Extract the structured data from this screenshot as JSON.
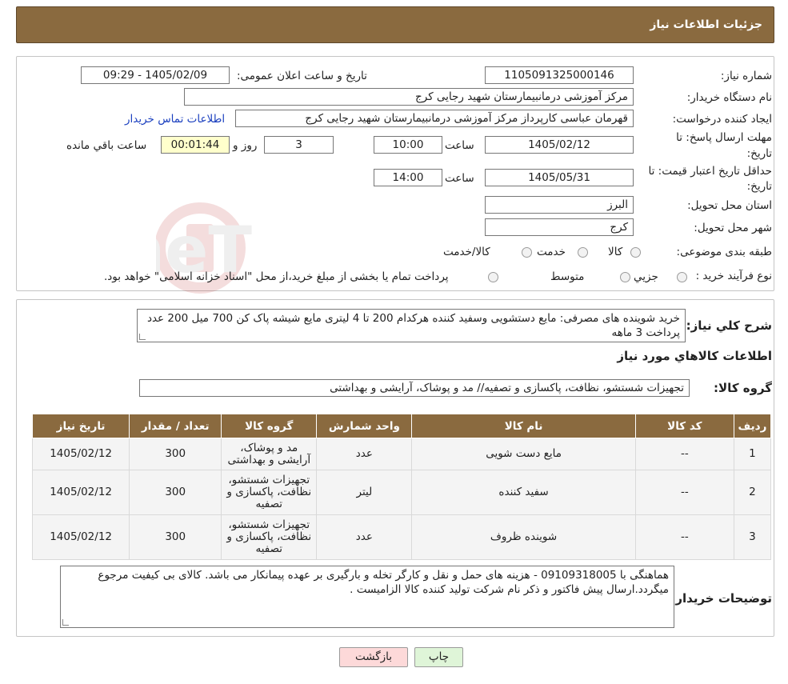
{
  "header": {
    "title": "جزئیات اطلاعات نیاز"
  },
  "form": {
    "need_number_label": "شماره نیاز:",
    "need_number": "1105091325000146",
    "announce_label": "تاریخ و ساعت اعلان عمومی:",
    "announce_value": "1405/02/09 - 09:29",
    "buyer_label": "نام دستگاه خریدار:",
    "buyer_value": "مرکز آموزشی درمانبیمارستان شهید رجایی کرج",
    "creator_label": "ایجاد کننده درخواست:",
    "creator_value": "قهرمان عباسی کارپرداز مرکز آموزشی درمانبیمارستان شهید رجایی کرج",
    "contact_link": "اطلاعات تماس خریدار",
    "reply_label_line1": "مهلت ارسال پاسخ: تا",
    "reply_label_line2": "تاریخ:",
    "reply_date": "1405/02/12",
    "time_label": "ساعت",
    "reply_time": "10:00",
    "days_value": "3",
    "days_label": "روز و",
    "remaining_value": "00:01:44",
    "remaining_label": "ساعت باقي مانده",
    "validity_label_line1": "حداقل تاریخ اعتبار قیمت: تا",
    "validity_label_line2": "تاریخ:",
    "validity_date": "1405/05/31",
    "validity_time": "14:00",
    "province_label": "استان محل تحویل:",
    "province_value": "البرز",
    "city_label": "شهر محل تحویل:",
    "city_value": "کرج",
    "category_label": "طبقه بندی موضوعی:",
    "category_options": [
      "کالا",
      "خدمت",
      "کالا/خدمت"
    ],
    "process_label": "نوع فرآیند خرید :",
    "process_options": [
      "جزیي",
      "متوسط"
    ],
    "process_note": "پرداخت تمام یا بخشی از مبلغ خرید،از محل \"اسناد خزانه اسلامی\" خواهد بود."
  },
  "details": {
    "description_label": "شرح کلي نياز:",
    "description_text": "خرید شوینده های مصرفی: مایع دستشویی وسفید کننده هرکدام  200 تا 4 لیتری مایع  شیشه پاک کن  700 میل  200 عدد   پرداخت  3 ماهه",
    "goods_info_title": "اطلاعات کالاهاي مورد نياز",
    "goods_group_label": "گروه کالا:",
    "goods_group_value": "تجهیزات شستشو، نظافت، پاکسازی و تصفیه// مد و پوشاک، آرایشی و بهداشتی"
  },
  "table": {
    "headers": [
      "ردیف",
      "کد کالا",
      "نام کالا",
      "واحد شمارش",
      "گروه کالا",
      "تعداد / مقدار",
      "تاریخ نیاز"
    ],
    "rows": [
      {
        "row": "1",
        "code": "--",
        "name": "مایع دست شویی",
        "unit": "عدد",
        "group": "مد و پوشاک، آرایشی و بهداشتی",
        "qty": "300",
        "date": "1405/02/12"
      },
      {
        "row": "2",
        "code": "--",
        "name": "سفید کننده",
        "unit": "لیتر",
        "group": "تجهیزات شستشو، نظافت، پاکسازی و تصفیه",
        "qty": "300",
        "date": "1405/02/12"
      },
      {
        "row": "3",
        "code": "--",
        "name": "شوینده ظروف",
        "unit": "عدد",
        "group": "تجهیزات شستشو، نظافت، پاکسازی و تصفیه",
        "qty": "300",
        "date": "1405/02/12"
      }
    ]
  },
  "buyer_notes": {
    "label": "توضیحات خریدار:",
    "text": "هماهنگی با 09109318005 - هزینه های  حمل و نقل و کارگر تخله و بارگیری بر عهده پیمانکار می باشد. کالای بی کیفیت مرجوع میگردد.ارسال پیش فاکتور و ذکر نام شرکت تولید کننده کالا الزامیست ."
  },
  "buttons": {
    "print": "چاپ",
    "back": "بازگشت"
  },
  "watermark": {
    "text": "AriaTender.neT"
  },
  "colors": {
    "header_bg": "#8a6a3f",
    "link": "#1a3fbf",
    "back_button": "#fdd9d9",
    "print_button": "#dff5d8",
    "remaining_bg": "#ffffcc"
  }
}
